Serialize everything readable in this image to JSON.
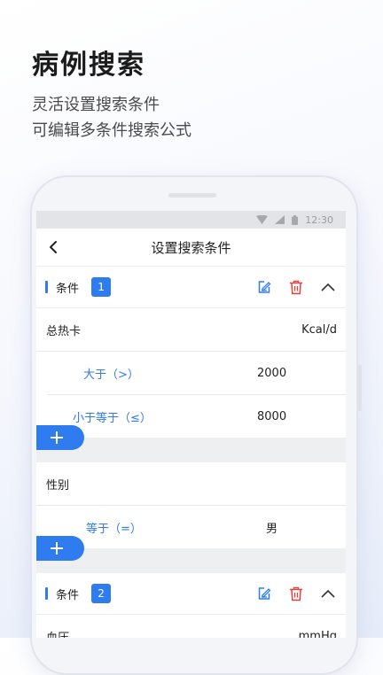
{
  "hero": {
    "title": "病例搜索",
    "subtitle_line1": "灵活设置搜索条件",
    "subtitle_line2": "可编辑多条件搜索公式"
  },
  "status_bar": {
    "time": "12:30",
    "icons": [
      "wifi-icon",
      "signal-icon",
      "battery-icon"
    ]
  },
  "nav": {
    "title": "设置搜索条件",
    "back_icon": "chevron-left-icon"
  },
  "accent_color": "#2f7cf0",
  "delete_color": "#e8413c",
  "conditions": [
    {
      "label": "条件",
      "number": "1",
      "fields": [
        {
          "name": "总热卡",
          "unit": "Kcal/d",
          "rules": [
            {
              "operator": "大于（>）",
              "value": "2000"
            },
            {
              "operator": "小于等于（≤）",
              "value": "8000"
            }
          ]
        },
        {
          "name": "性别",
          "unit": "",
          "rules": [
            {
              "operator": "等于（=）",
              "value": "男"
            }
          ]
        }
      ]
    },
    {
      "label": "条件",
      "number": "2",
      "fields": [
        {
          "name": "血压",
          "unit": "mmHg",
          "rules": []
        }
      ]
    }
  ],
  "icons": {
    "edit": "edit-icon",
    "delete": "trash-icon",
    "collapse": "chevron-up-icon",
    "add": "plus-icon"
  }
}
